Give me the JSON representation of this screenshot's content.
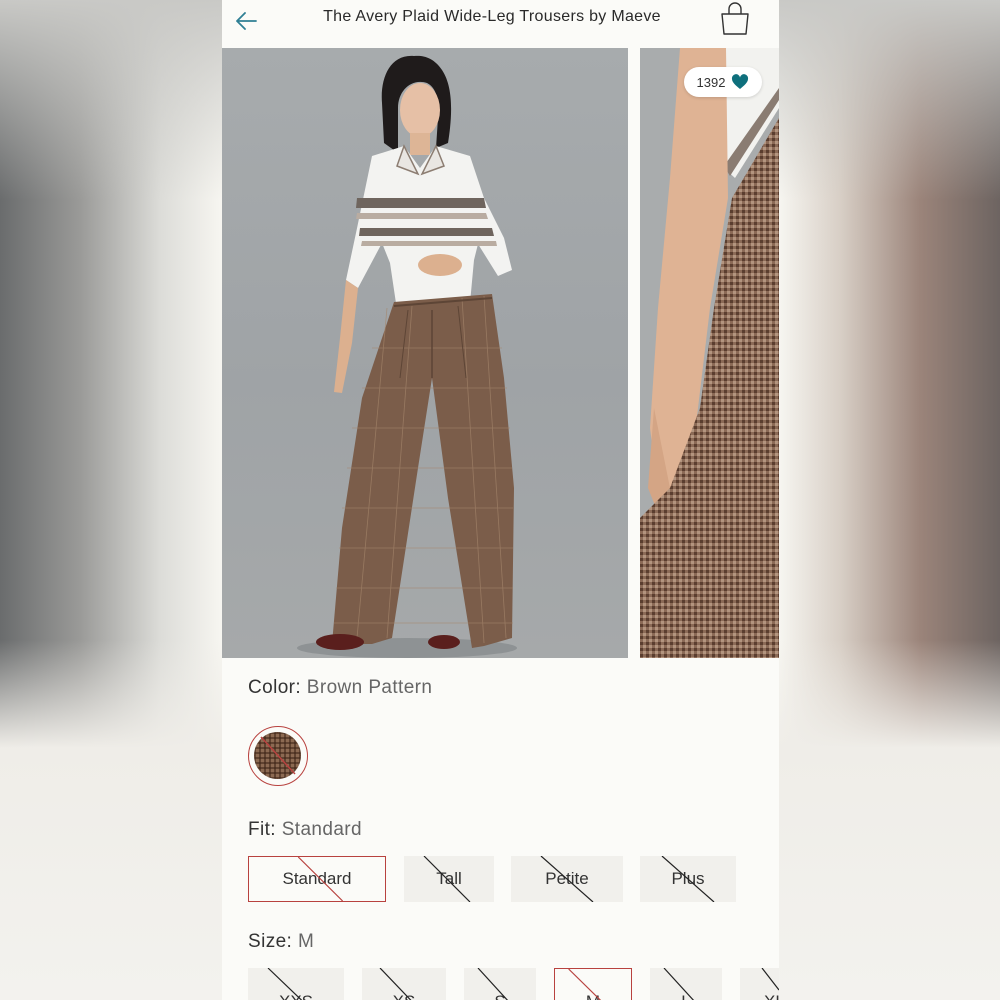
{
  "header": {
    "title": "The Avery Plaid Wide-Leg Trousers by Maeve",
    "back_icon": "arrow-left-icon",
    "bag_icon": "shopping-bag-icon"
  },
  "gallery": {
    "likes": "1392",
    "like_icon": "heart-icon",
    "heart_color": "#0e6f7c"
  },
  "color": {
    "label": "Color:",
    "value": "Brown Pattern"
  },
  "fit": {
    "label": "Fit:",
    "value": "Standard",
    "options": [
      "Standard",
      "Tall",
      "Petite",
      "Plus"
    ]
  },
  "size": {
    "label": "Size:",
    "value": "M",
    "options": [
      "XXS",
      "XS",
      "S",
      "M",
      "L",
      "XL"
    ]
  },
  "colors": {
    "accent_red": "#b8423f",
    "back_arrow": "#2f7f94"
  }
}
